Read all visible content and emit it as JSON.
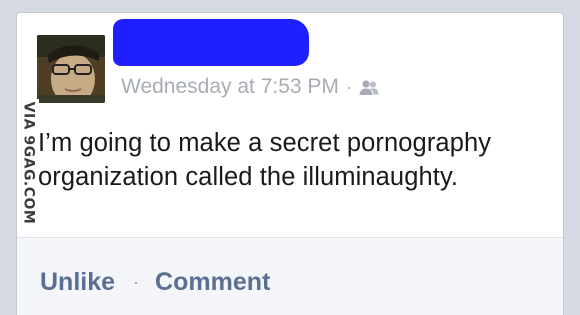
{
  "post": {
    "timestamp": "Wednesday at 7:53 PM",
    "separator": "·",
    "audience_icon": "friends-icon",
    "text": "I’m going to make a secret pornography organization called the illuminaughty."
  },
  "watermark": {
    "text": "VIA 9GAG.COM"
  },
  "actions": {
    "unlike_label": "Unlike",
    "separator": "·",
    "comment_label": "Comment"
  },
  "colors": {
    "background": "#d6dae3",
    "redaction": "#1f1fff",
    "action_text": "#5b6f93",
    "meta_text": "#a7acb5"
  }
}
